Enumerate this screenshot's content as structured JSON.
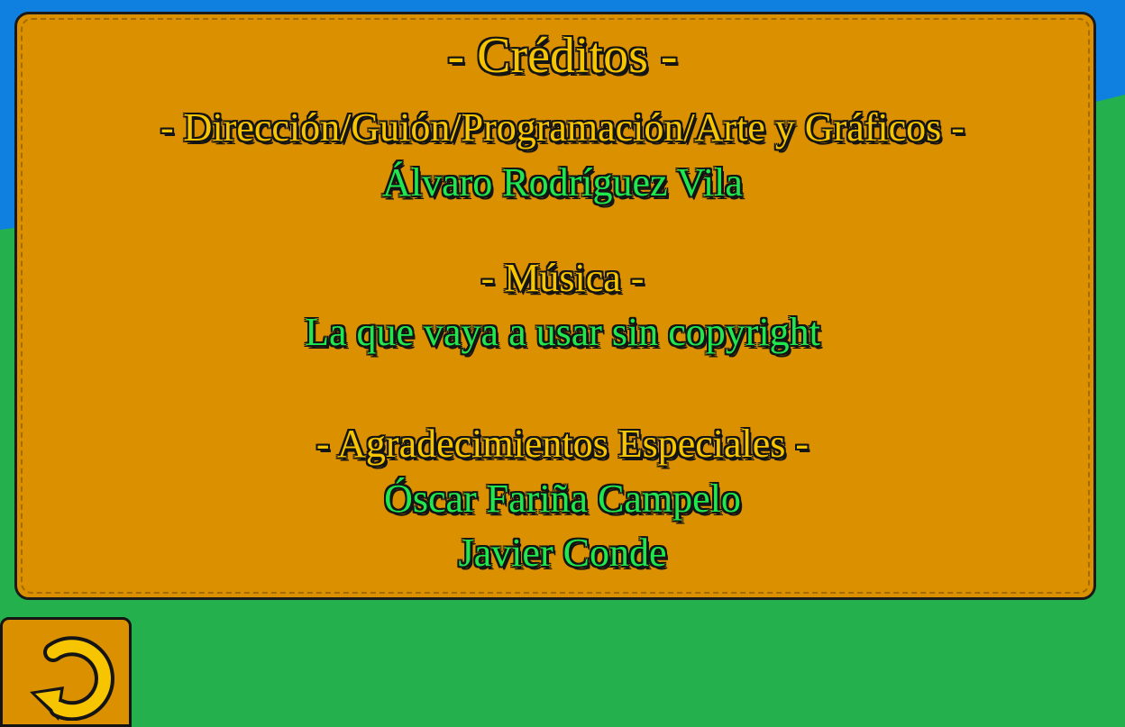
{
  "colors": {
    "sky": "#0F7FE0",
    "grass": "#23B04D",
    "panel": "#DB9000",
    "heading_text": "#F7C400",
    "name_text": "#1FE84E",
    "outline": "#141414"
  },
  "credits": {
    "title": "- Créditos -",
    "direction_heading": "- Dirección/Guión/Programación/Arte y Gráficos -",
    "direction_name": "Álvaro Rodríguez Vila",
    "music_heading": "- Música -",
    "music_name": "La que vaya a usar sin copyright",
    "thanks_heading": "- Agradecimientos Especiales -",
    "thanks_name_1": "Óscar Fariña Campelo",
    "thanks_name_2": "Javier Conde"
  },
  "back_button": {
    "icon": "back-arrow-icon"
  }
}
